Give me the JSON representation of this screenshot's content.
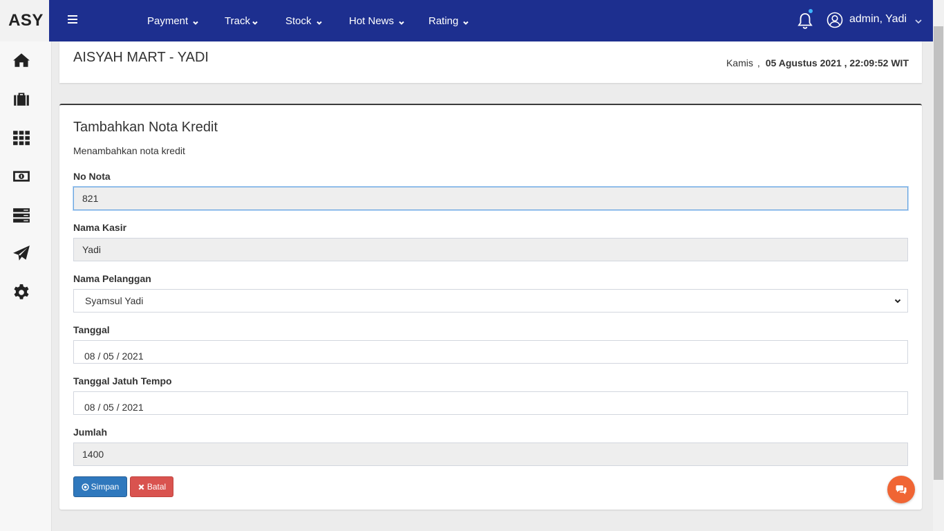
{
  "brand": {
    "text": "ASY"
  },
  "sidebar": {
    "items": [
      {
        "name": "home",
        "icon": "home-icon"
      },
      {
        "name": "briefcase",
        "icon": "briefcase-icon"
      },
      {
        "name": "grid",
        "icon": "grid-icon"
      },
      {
        "name": "money",
        "icon": "money-icon"
      },
      {
        "name": "server",
        "icon": "server-icon"
      },
      {
        "name": "send",
        "icon": "paper-plane-icon"
      },
      {
        "name": "settings",
        "icon": "gear-icon"
      }
    ]
  },
  "navbar": {
    "menu": [
      "Payment",
      "Track",
      "Stock",
      "Hot News",
      "Rating"
    ],
    "user_name": "admin, Yadi",
    "bg_color": "#1d2f8f"
  },
  "header": {
    "store_title": "AISYAH MART - YADI",
    "day": "Kamis",
    "separator": ",",
    "date_time": "05 Agustus 2021 , 22:09:52 WIT"
  },
  "form": {
    "title": "Tambahkan Nota Kredit",
    "subtitle": "Menambahkan nota kredit",
    "fields": {
      "no_nota": {
        "label": "No Nota",
        "value": "821"
      },
      "nama_kasir": {
        "label": "Nama Kasir",
        "value": "Yadi"
      },
      "nama_pelanggan": {
        "label": "Nama Pelanggan",
        "value": "Syamsul Yadi"
      },
      "tanggal": {
        "label": "Tanggal",
        "value": "08 / 05 / 2021"
      },
      "tanggal_jatuh_tempo": {
        "label": "Tanggal Jatuh Tempo",
        "value": "08 / 05 / 2021"
      },
      "jumlah": {
        "label": "Jumlah",
        "value": "1400"
      }
    },
    "buttons": {
      "save": "Simpan",
      "cancel": "Batal"
    }
  },
  "colors": {
    "save_button": "#2f78bd",
    "cancel_button": "#d9534f",
    "chat_button": "#f06534"
  }
}
